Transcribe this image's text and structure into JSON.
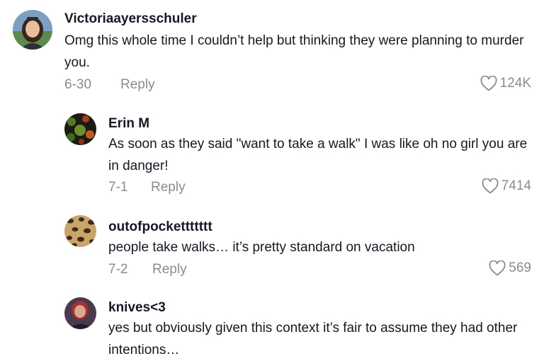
{
  "comments": [
    {
      "username": "Victoriaayersschuler",
      "text": "Omg this whole time I couldn’t help but thinking they were planning to murder you.",
      "date": "6-30",
      "reply_label": "Reply",
      "likes": "124K",
      "avatar": "avatar-woman-smiling"
    },
    {
      "username": "Erin M",
      "text": "As soon as they said \"want to take a walk\" I was like oh no girl you are in danger!",
      "date": "7-1",
      "reply_label": "Reply",
      "likes": "7414",
      "avatar": "avatar-dark-pattern"
    },
    {
      "username": "outofpockettttttt",
      "text": "people take walks… it’s pretty standard on vacation",
      "date": "7-2",
      "reply_label": "Reply",
      "likes": "569",
      "avatar": "avatar-leopard-print"
    },
    {
      "username": "knives<3",
      "text": "yes but obviously given this context it’s fair to assume they had other intentions…",
      "avatar": "avatar-person-red-hair"
    }
  ],
  "icons": {
    "like": "heart-outline-icon"
  },
  "colors": {
    "primary_text": "#161823",
    "secondary_text": "#8a8b91",
    "background": "#ffffff"
  }
}
